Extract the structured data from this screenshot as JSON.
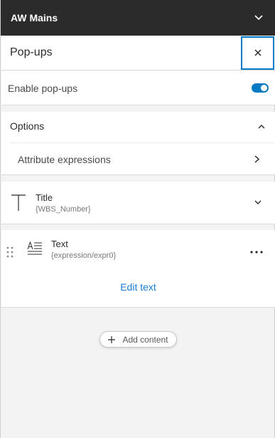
{
  "layer_bar": {
    "title": "AW Mains",
    "icon": "chevron-down-icon"
  },
  "panel": {
    "title": "Pop-ups",
    "close_icon": "close-icon"
  },
  "enable": {
    "label": "Enable pop-ups",
    "enabled": true
  },
  "options": {
    "label": "Options",
    "icon": "chevron-up-icon",
    "attribute_expressions": "Attribute expressions"
  },
  "title_element": {
    "name": "Title",
    "value": "{WBS_Number}",
    "icon": "title-t-icon"
  },
  "text_element": {
    "name": "Text",
    "value": "{expression/expr0}",
    "icon": "text-align-icon",
    "edit_label": "Edit text"
  },
  "add_content": {
    "label": "Add content",
    "icon": "plus-icon"
  },
  "colors": {
    "accent": "#007ac2",
    "header_bg": "#2b2b2b",
    "link": "#1a7bd0"
  }
}
